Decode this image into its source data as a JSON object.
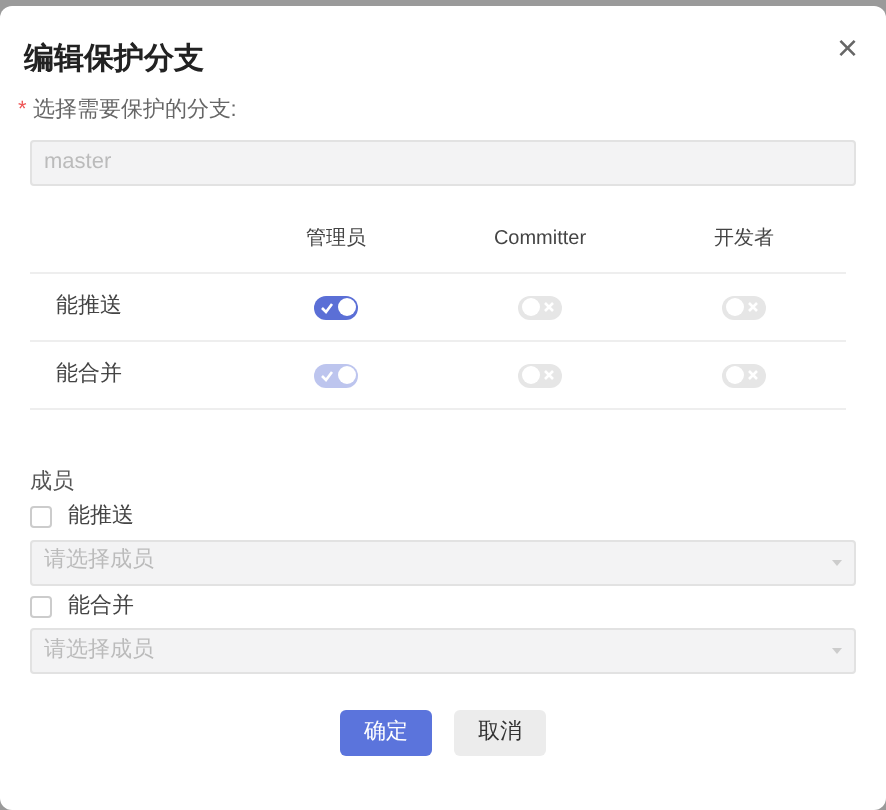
{
  "dialog": {
    "title": "编辑保护分支",
    "close": "×"
  },
  "branch_field": {
    "required_mark": "*",
    "label": "选择需要保护的分支:",
    "value": "master",
    "disabled": true
  },
  "permissions": {
    "columns": [
      "管理员",
      "Committer",
      "开发者"
    ],
    "rows": [
      {
        "label": "能推送",
        "toggles": [
          {
            "on": true,
            "disabled": false
          },
          {
            "on": false,
            "disabled": false
          },
          {
            "on": false,
            "disabled": false
          }
        ]
      },
      {
        "label": "能合并",
        "toggles": [
          {
            "on": true,
            "disabled": true
          },
          {
            "on": false,
            "disabled": false
          },
          {
            "on": false,
            "disabled": false
          }
        ]
      }
    ]
  },
  "members": {
    "label": "成员",
    "groups": [
      {
        "label": "能推送",
        "checked": false,
        "placeholder": "请选择成员",
        "disabled": true
      },
      {
        "label": "能合并",
        "checked": false,
        "placeholder": "请选择成员",
        "disabled": true
      }
    ]
  },
  "buttons": [
    {
      "label": "确定",
      "kind": "primary"
    },
    {
      "label": "取消",
      "kind": "secondary"
    }
  ]
}
